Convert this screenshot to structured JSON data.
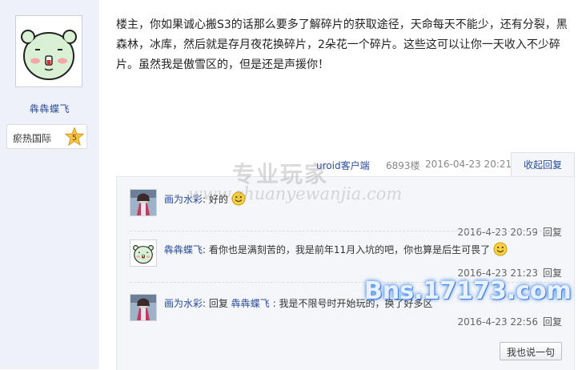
{
  "user": {
    "name": "犇犇蝶飞",
    "rank_label": "瘀热国际",
    "rank_level": "5"
  },
  "post": {
    "text": "楼主，你如果诚心搬S3的话那么要多了解碎片的获取途径，天命每天不能少，还有分裂，黑森林，冰库，然后就是存月夜花换碎片，2朵花一个碎片。这些这可以让你一天收入不少碎片。虽然我是傲雪区的，但是还是声援你！"
  },
  "replybar": {
    "client": "uroid客户端",
    "floor": "6893楼",
    "date": "2016-04-23 20:21",
    "collapse": "收起回复"
  },
  "subreplies": [
    {
      "author": "画为水彩",
      "colon": ":",
      "text": "好的",
      "time": "2016-4-23 20:59",
      "reply": "回复",
      "avatar": "character-avatar"
    },
    {
      "author": "犇犇蝶飞",
      "colon": ":",
      "text": "看你也是满刻苦的，我是前年11月入坑的吧，你也算是后生可畏了",
      "time": "2016-4-23 21:23",
      "reply": "回复",
      "avatar": "bear-avatar"
    },
    {
      "author": "画为水彩",
      "colon": ":",
      "prefix": "回复",
      "target": "犇犇蝶飞",
      "target_colon": ":",
      "text": "我是不限号时开始玩的，换了好多区",
      "time": "2016-4-23 22:56",
      "reply": "回复",
      "avatar": "character-avatar"
    }
  ],
  "say_button": "我也说一句",
  "watermarks": {
    "cn": "专业玩家",
    "url": "www.zhuanyewanjia.com",
    "site": "Bns.17173.com"
  },
  "colors": {
    "link": "#2b4d9b",
    "sidebar_bg": "#eef1f7",
    "subbox_bg": "#f4f6f9"
  }
}
